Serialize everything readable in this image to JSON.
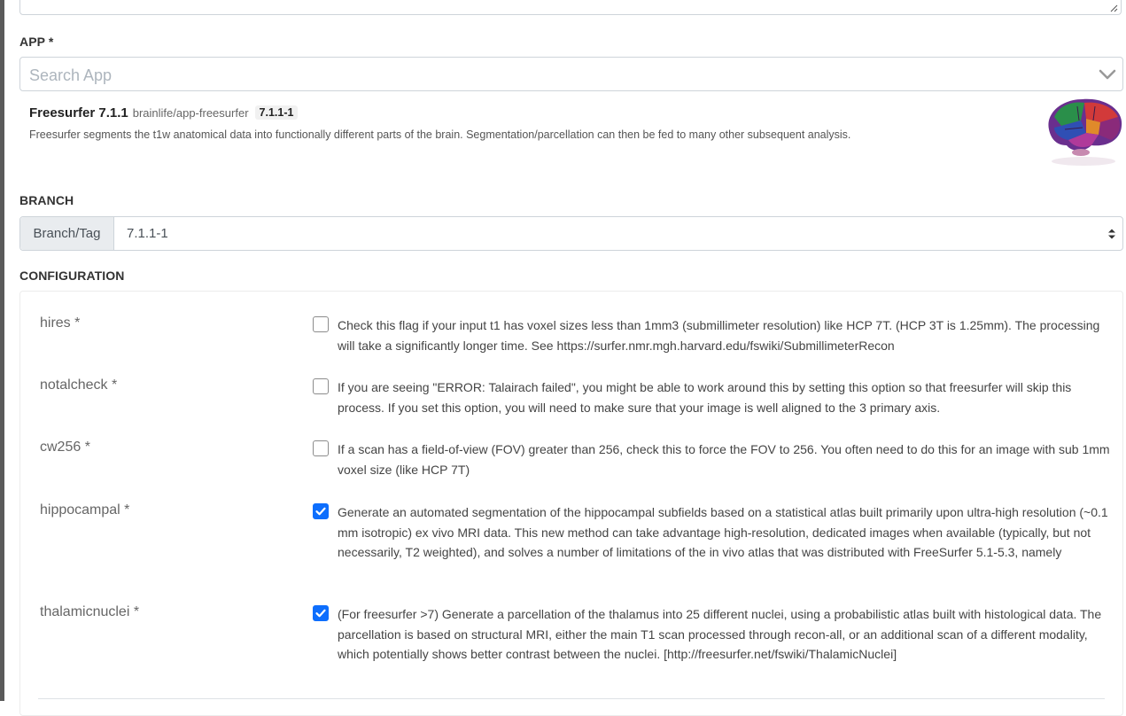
{
  "sections": {
    "app_label": "APP *",
    "branch_label": "BRANCH",
    "config_label": "CONFIGURATION"
  },
  "app_search": {
    "placeholder": "Search App"
  },
  "app": {
    "name": "Freesurfer 7.1.1",
    "repo": "brainlife/app-freesurfer",
    "version": "7.1.1-1",
    "description": "Freesurfer segments the t1w anatomical data into functionally different parts of the brain. Segmentation/parcellation can then be fed to many other subsequent analysis."
  },
  "branch": {
    "addon_label": "Branch/Tag",
    "value": "7.1.1-1"
  },
  "config": [
    {
      "name": "hires *",
      "checked": false,
      "description": "Check this flag if your input t1 has voxel sizes less than 1mm3 (submillimeter resolution) like HCP 7T. (HCP 3T is 1.25mm). The processing will take a significantly longer time. See https://surfer.nmr.mgh.harvard.edu/fswiki/SubmillimeterRecon"
    },
    {
      "name": "notalcheck *",
      "checked": false,
      "description": "If you are seeing \"ERROR: Talairach failed\", you might be able to work around this by setting this option so that freesurfer will skip this process. If you set this option, you will need to make sure that your image is well aligned to the 3 primary axis."
    },
    {
      "name": "cw256 *",
      "checked": false,
      "description": "If a scan has a field-of-view (FOV) greater than 256, check this to force the FOV to 256. You often need to do this for an image with sub 1mm voxel size (like HCP 7T)"
    },
    {
      "name": "hippocampal *",
      "checked": true,
      "description": "Generate an automated segmentation of the hippocampal subfields based on a statistical atlas built primarily upon ultra-high resolution (~0.1 mm isotropic) ex vivo MRI data. This new method can take advantage high-resolution, dedicated images when available (typically, but not necessarily, T2 weighted), and solves a number of limitations of the in vivo atlas that was distributed with FreeSurfer 5.1-5.3, namely"
    },
    {
      "name": "thalamicnuclei *",
      "checked": true,
      "description": "(For freesurfer >7) Generate a parcellation of the thalamus into 25 different nuclei, using a probabilistic atlas built with histological data. The parcellation is based on structural MRI, either the main T1 scan processed through recon-all, or an additional scan of a different modality, which potentially shows better contrast between the nuclei. [http://freesurfer.net/fswiki/ThalamicNuclei]"
    }
  ],
  "colors": {
    "accent": "#0d6efd",
    "border": "#ced4da",
    "addon_bg": "#e9ecef"
  },
  "icons": {
    "app_select": "chevron-down-icon",
    "branch_select": "sort-arrows-icon",
    "checkbox": "check-icon",
    "logo": "brain-logo-icon"
  }
}
